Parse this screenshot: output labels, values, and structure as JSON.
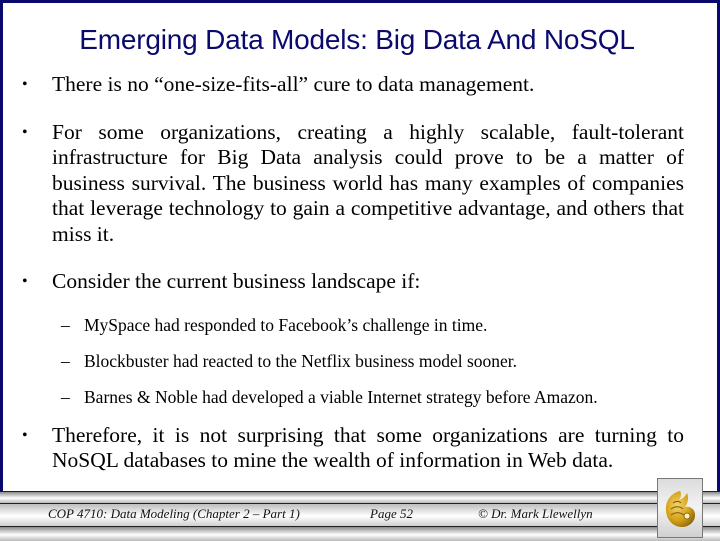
{
  "slide": {
    "title": "Emerging Data Models: Big Data And NoSQL",
    "bullets": [
      {
        "symbol": "•",
        "text": "There is no “one-size-fits-all” cure to data management."
      },
      {
        "symbol": "•",
        "text": "For some organizations, creating a highly scalable, fault-tolerant infrastructure for Big Data analysis could prove to be a matter of business survival.  The business world has many examples of companies that leverage technology to gain a competitive advantage, and others that miss it."
      },
      {
        "symbol": "•",
        "text": "Consider the current business landscape if:",
        "sub_items": [
          {
            "symbol": "–",
            "text": "MySpace had responded to Facebook’s challenge in time."
          },
          {
            "symbol": "–",
            "text": "Blockbuster had reacted to the Netflix business model sooner."
          },
          {
            "symbol": "–",
            "text": "Barnes & Noble had developed a viable Internet strategy before Amazon."
          }
        ]
      },
      {
        "symbol": "•",
        "text": "Therefore, it is not surprising that some organizations are turning to NoSQL databases to mine the wealth of information in Web data."
      }
    ]
  },
  "footer": {
    "course": "COP 4710: Data Modeling (Chapter 2 – Part 1)",
    "page": "Page 52",
    "copyright": "© Dr. Mark Llewellyn",
    "logo_icon": "pegasus-logo-icon"
  },
  "colors": {
    "title": "#0a0a6e",
    "frame": "#0a0a6e",
    "logo_gold": "#d4a017"
  }
}
